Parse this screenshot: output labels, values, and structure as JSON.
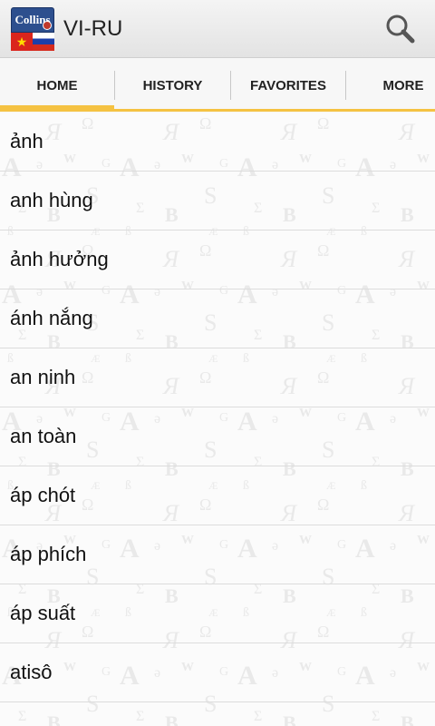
{
  "app": {
    "title": "VI-RU",
    "logo_text": "Collins"
  },
  "tabs": [
    {
      "label": "HOME",
      "active": true
    },
    {
      "label": "HISTORY",
      "active": false
    },
    {
      "label": "FAVORITES",
      "active": false
    },
    {
      "label": "MORE",
      "active": false
    }
  ],
  "words": [
    "ảnh",
    "anh hùng",
    "ảnh hưởng",
    "ánh nắng",
    "an ninh",
    "an toàn",
    "áp chót",
    "áp phích",
    "áp suất",
    "atisô"
  ],
  "colors": {
    "accent": "#f5c242",
    "logo_blue": "#2d4f8e"
  },
  "icons": {
    "search": "search-icon"
  }
}
